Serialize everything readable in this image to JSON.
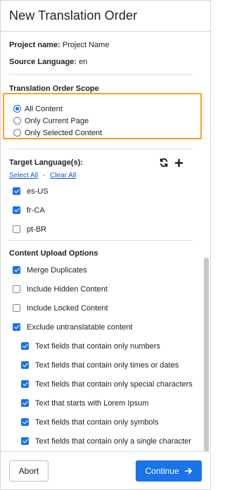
{
  "header": {
    "title": "New Translation Order"
  },
  "project": {
    "name_label": "Project name:",
    "name_value": "Project Name",
    "source_label": "Source Language:",
    "source_value": "en"
  },
  "scope": {
    "title": "Translation Order Scope",
    "options": [
      {
        "label": "All Content",
        "selected": true
      },
      {
        "label": "Only Current Page",
        "selected": false
      },
      {
        "label": "Only Selected Content",
        "selected": false
      }
    ]
  },
  "target": {
    "title": "Target Language(s):",
    "select_all": "Select All",
    "separator": "-",
    "clear_all": "Clear All",
    "languages": [
      {
        "label": "es-US",
        "checked": true
      },
      {
        "label": "fr-CA",
        "checked": true
      },
      {
        "label": "pt-BR",
        "checked": false
      }
    ]
  },
  "upload": {
    "title": "Content Upload Options",
    "options": [
      {
        "label": "Merge Duplicates",
        "checked": true
      },
      {
        "label": "Include Hidden Content",
        "checked": false
      },
      {
        "label": "Include Locked Content",
        "checked": false
      },
      {
        "label": "Exclude untranslatable content",
        "checked": true
      }
    ],
    "sub_options": [
      {
        "label": "Text fields that contain only numbers",
        "checked": true
      },
      {
        "label": "Text fields that contain only times or dates",
        "checked": true
      },
      {
        "label": "Text fields that contain only special characters",
        "checked": true
      },
      {
        "label": "Text that starts with Lorem Ipsum",
        "checked": true
      },
      {
        "label": "Text fields that contain only symbols",
        "checked": true
      },
      {
        "label": "Text fields that contain only a single character",
        "checked": true
      }
    ]
  },
  "footer": {
    "abort_label": "Abort",
    "continue_label": "Continue"
  },
  "colors": {
    "accent": "#1a73e8",
    "highlight": "#f5a020"
  }
}
